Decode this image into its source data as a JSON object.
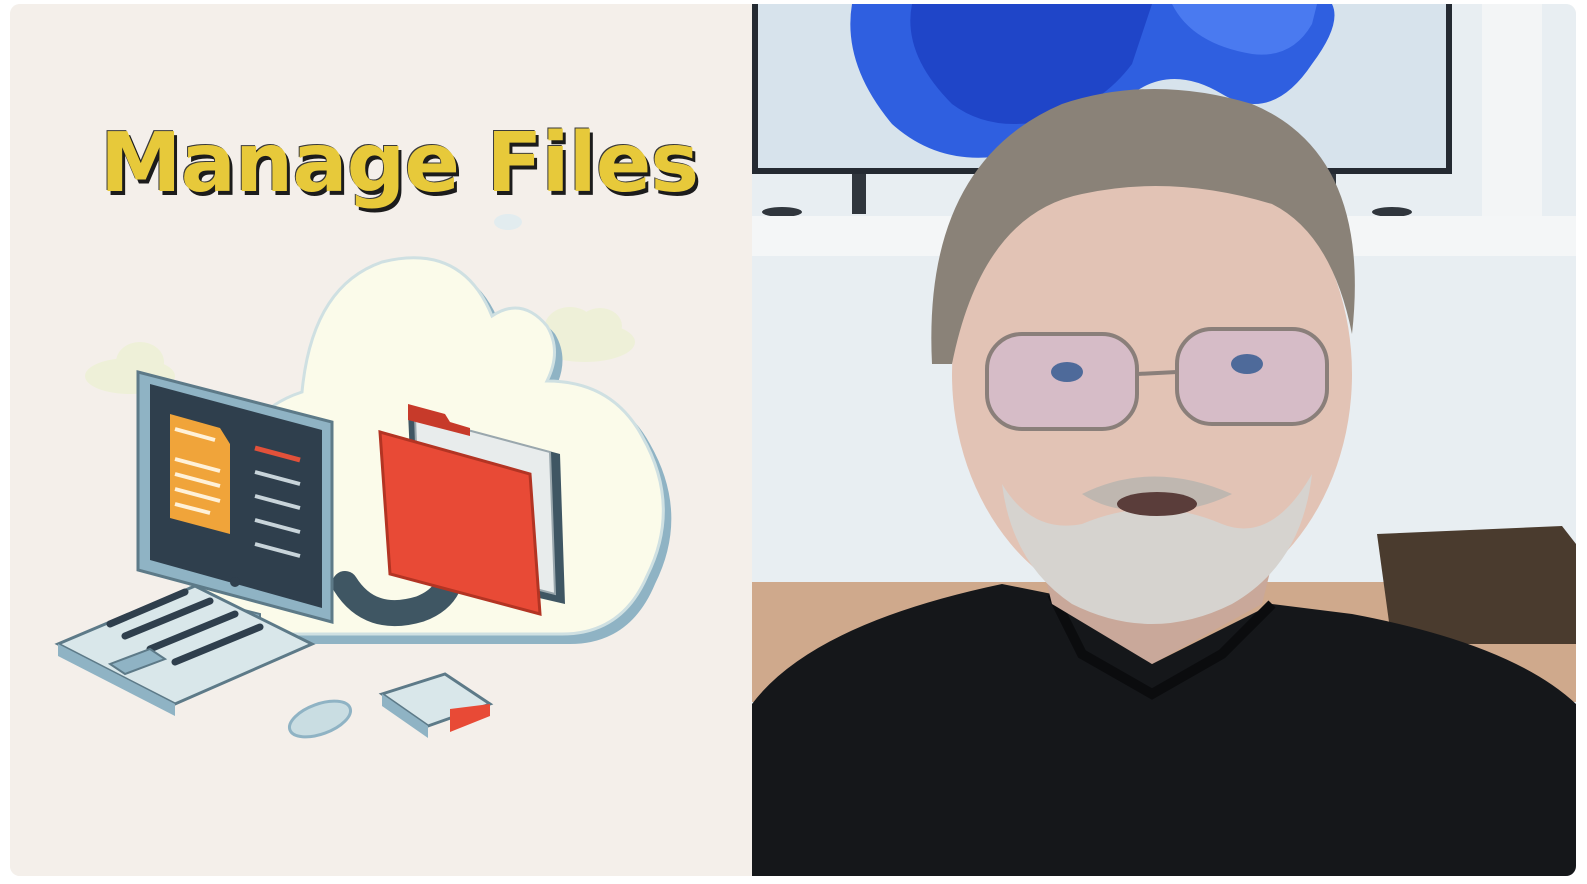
{
  "thumbnail": {
    "title": "Manage Files",
    "title_color": "#e7c93a",
    "left_background": "#f4efea"
  },
  "illustration": {
    "icons": [
      "cloud-icon",
      "computer-monitor-icon",
      "folder-icon",
      "document-icon",
      "keyboard-icon",
      "mouse-icon",
      "usb-drive-icon"
    ]
  },
  "video": {
    "subject": "presenter-webcam"
  }
}
